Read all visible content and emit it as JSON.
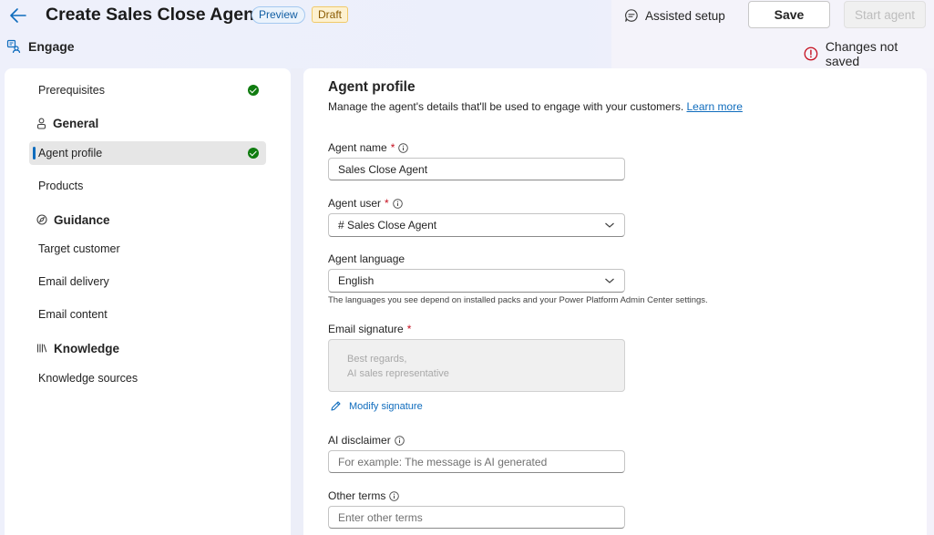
{
  "header": {
    "title": "Create Sales Close Agent",
    "preview_badge": "Preview",
    "draft_badge": "Draft",
    "section": "Engage",
    "assisted_setup": "Assisted setup",
    "save": "Save",
    "start_agent": "Start agent",
    "unsaved_status": "Changes not saved"
  },
  "nav": {
    "items": {
      "prerequisites": {
        "label": "Prerequisites",
        "status": "complete"
      },
      "agent_profile": {
        "label": "Agent profile",
        "status": "complete",
        "active": true
      },
      "products": {
        "label": "Products"
      },
      "target_customer": {
        "label": "Target customer"
      },
      "email_delivery": {
        "label": "Email delivery"
      },
      "email_content": {
        "label": "Email content"
      },
      "knowledge_sources": {
        "label": "Knowledge sources"
      }
    },
    "groups": {
      "general": {
        "label": "General",
        "icon": "person-icon"
      },
      "guidance": {
        "label": "Guidance",
        "icon": "compass-icon"
      },
      "knowledge": {
        "label": "Knowledge",
        "icon": "library-icon"
      }
    }
  },
  "main": {
    "title": "Agent profile",
    "description": "Manage the agent's details that'll be used to engage with your customers.",
    "learn_more": "Learn more",
    "agent_name": {
      "label": "Agent name",
      "value": "Sales Close Agent"
    },
    "agent_user": {
      "label": "Agent user",
      "value": "# Sales Close Agent"
    },
    "agent_language": {
      "label": "Agent language",
      "value": "English",
      "helper": "The languages you see depend on installed packs and your Power Platform Admin Center settings."
    },
    "email_signature": {
      "label": "Email signature",
      "line1": "Best regards,",
      "line2": "AI sales representative"
    },
    "modify_signature": "Modify signature",
    "ai_disclaimer": {
      "label": "AI disclaimer",
      "placeholder": "For example: The message is AI generated"
    },
    "other_terms": {
      "label": "Other terms",
      "placeholder": "Enter other terms"
    }
  },
  "colors": {
    "accent": "#0f6cbd",
    "success": "#107c10",
    "error": "#c50f1f",
    "draft": "#fdf1d0"
  }
}
